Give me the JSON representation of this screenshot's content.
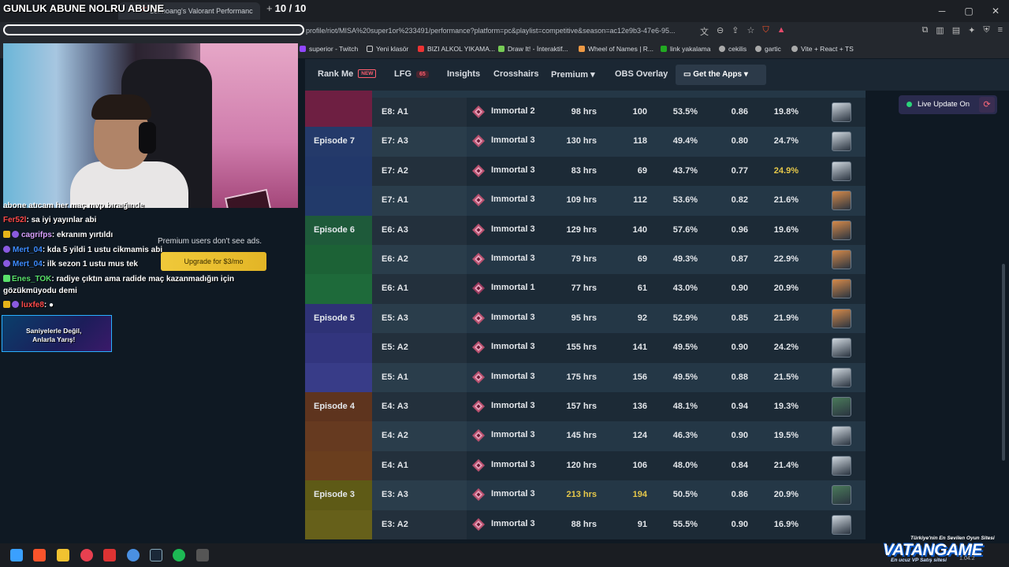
{
  "overlay_title": "GUNLUK ABUNE NOLRU ABUNE",
  "browser": {
    "tab_title": "10#hoang's Valorant Performanc",
    "tab_counter": "10 / 10",
    "url": "profile/riot/MISA%20super1or%233491/performance?platform=pc&playlist=competitive&season=ac12e9b3-47e6-95...",
    "bookmarks": [
      "superior - Twitch",
      "Yeni klasör",
      "BIZI ALKOL YIKAMA...",
      "Draw It! - İnteraktif...",
      "Wheel of Names | R...",
      "link yakalama",
      "cekilis",
      "gartic",
      "Vite + React + TS"
    ]
  },
  "nav": {
    "rank_me": "Rank Me",
    "new_badge": "NEW",
    "lfg": "LFG",
    "lfg_count": "65",
    "insights": "Insights",
    "crosshairs": "Crosshairs",
    "premium": "Premium",
    "obs_overlay": "OBS Overlay",
    "get_apps": "Get the Apps"
  },
  "live_update": "Live Update On",
  "colors": {
    "ep8": "#7a2248",
    "ep7": "#243a6a",
    "ep6": "#1e6a3a",
    "ep5": "#353a86",
    "ep4": "#6a3a22",
    "ep3": "#6a6418",
    "highlight": "#e6c84a"
  },
  "rows": [
    {
      "episode": "",
      "ep_color": "#6e1f42",
      "season": "E8: A1",
      "rank": "Immortal 2",
      "rank_icon": "immortal-2",
      "hrs": "98 hrs",
      "matches": "100",
      "win": "53.5%",
      "kd": "0.86",
      "hs": "19.8%",
      "agent_color": "#cfd7de",
      "hl_hrs": false,
      "hl_matches": false,
      "hl_hs": false
    },
    {
      "episode": "Episode 7",
      "ep_color": "#243a6a",
      "season": "E7: A3",
      "rank": "Immortal 3",
      "rank_icon": "immortal-3",
      "hrs": "130 hrs",
      "matches": "118",
      "win": "49.4%",
      "kd": "0.80",
      "hs": "24.7%",
      "agent_color": "#cfd7de",
      "hl_hrs": false,
      "hl_matches": false,
      "hl_hs": false
    },
    {
      "episode": "",
      "ep_color": "#22386a",
      "season": "E7: A2",
      "rank": "Immortal 3",
      "rank_icon": "immortal-3",
      "hrs": "83 hrs",
      "matches": "69",
      "win": "43.7%",
      "kd": "0.77",
      "hs": "24.9%",
      "agent_color": "#cfd7de",
      "hl_hrs": false,
      "hl_matches": false,
      "hl_hs": true
    },
    {
      "episode": "",
      "ep_color": "#223a6a",
      "season": "E7: A1",
      "rank": "Immortal 3",
      "rank_icon": "immortal-3",
      "hrs": "109 hrs",
      "matches": "112",
      "win": "53.6%",
      "kd": "0.82",
      "hs": "21.6%",
      "agent_color": "#d58a4a",
      "hl_hrs": false,
      "hl_matches": false,
      "hl_hs": false
    },
    {
      "episode": "Episode 6",
      "ep_color": "#1e5a3a",
      "season": "E6: A3",
      "rank": "Immortal 3",
      "rank_icon": "immortal-3",
      "hrs": "129 hrs",
      "matches": "140",
      "win": "57.6%",
      "kd": "0.96",
      "hs": "19.6%",
      "agent_color": "#d58a4a",
      "hl_hrs": false,
      "hl_matches": false,
      "hl_hs": false
    },
    {
      "episode": "",
      "ep_color": "#1c6236",
      "season": "E6: A2",
      "rank": "Immortal 3",
      "rank_icon": "immortal-3",
      "hrs": "79 hrs",
      "matches": "69",
      "win": "49.3%",
      "kd": "0.87",
      "hs": "22.9%",
      "agent_color": "#d58a4a",
      "hl_hrs": false,
      "hl_matches": false,
      "hl_hs": false
    },
    {
      "episode": "",
      "ep_color": "#1e6a3a",
      "season": "E6: A1",
      "rank": "Immortal 1",
      "rank_icon": "immortal-1",
      "hrs": "77 hrs",
      "matches": "61",
      "win": "43.0%",
      "kd": "0.90",
      "hs": "20.9%",
      "agent_color": "#d58a4a",
      "hl_hrs": false,
      "hl_matches": false,
      "hl_hs": false
    },
    {
      "episode": "Episode 5",
      "ep_color": "#2e3276",
      "season": "E5: A3",
      "rank": "Immortal 3",
      "rank_icon": "immortal-3",
      "hrs": "95 hrs",
      "matches": "92",
      "win": "52.9%",
      "kd": "0.85",
      "hs": "21.9%",
      "agent_color": "#d58a4a",
      "hl_hrs": false,
      "hl_matches": false,
      "hl_hs": false
    },
    {
      "episode": "",
      "ep_color": "#32357e",
      "season": "E5: A2",
      "rank": "Immortal 3",
      "rank_icon": "immortal-3",
      "hrs": "155 hrs",
      "matches": "141",
      "win": "49.5%",
      "kd": "0.90",
      "hs": "24.2%",
      "agent_color": "#cfd7de",
      "hl_hrs": false,
      "hl_matches": false,
      "hl_hs": false
    },
    {
      "episode": "",
      "ep_color": "#383c88",
      "season": "E5: A1",
      "rank": "Immortal 3",
      "rank_icon": "immortal-3",
      "hrs": "175 hrs",
      "matches": "156",
      "win": "49.5%",
      "kd": "0.88",
      "hs": "21.5%",
      "agent_color": "#cfd7de",
      "hl_hrs": false,
      "hl_matches": false,
      "hl_hs": false
    },
    {
      "episode": "Episode 4",
      "ep_color": "#5e341e",
      "season": "E4: A3",
      "rank": "Immortal 3",
      "rank_icon": "immortal-3",
      "hrs": "157 hrs",
      "matches": "136",
      "win": "48.1%",
      "kd": "0.94",
      "hs": "19.3%",
      "agent_color": "#4a7a5a",
      "hl_hrs": false,
      "hl_matches": false,
      "hl_hs": false
    },
    {
      "episode": "",
      "ep_color": "#663a20",
      "season": "E4: A2",
      "rank": "Immortal 3",
      "rank_icon": "immortal-3",
      "hrs": "145 hrs",
      "matches": "124",
      "win": "46.3%",
      "kd": "0.90",
      "hs": "19.5%",
      "agent_color": "#cfd7de",
      "hl_hrs": false,
      "hl_matches": false,
      "hl_hs": false
    },
    {
      "episode": "",
      "ep_color": "#6a3e1e",
      "season": "E4: A1",
      "rank": "Immortal 3",
      "rank_icon": "immortal-3",
      "hrs": "120 hrs",
      "matches": "106",
      "win": "48.0%",
      "kd": "0.84",
      "hs": "21.4%",
      "agent_color": "#cfd7de",
      "hl_hrs": false,
      "hl_matches": false,
      "hl_hs": false
    },
    {
      "episode": "Episode 3",
      "ep_color": "#5e5a16",
      "season": "E3: A3",
      "rank": "Immortal 3",
      "rank_icon": "immortal-3",
      "hrs": "213 hrs",
      "matches": "194",
      "win": "50.5%",
      "kd": "0.86",
      "hs": "20.9%",
      "agent_color": "#4a7a5a",
      "hl_hrs": true,
      "hl_matches": true,
      "hl_hs": false
    },
    {
      "episode": "",
      "ep_color": "#66601a",
      "season": "E3: A2",
      "rank": "Immortal 3",
      "rank_icon": "immortal-3",
      "hrs": "88 hrs",
      "matches": "91",
      "win": "55.5%",
      "kd": "0.90",
      "hs": "16.9%",
      "agent_color": "#cfd7de",
      "hl_hrs": false,
      "hl_matches": false,
      "hl_hs": false
    }
  ],
  "stream": {
    "chat": [
      {
        "user": "",
        "text": "abone atıcam her maç mvp bıraığınde"
      },
      {
        "user": "Fer52l",
        "text": "sa iyi yayınlar abi"
      },
      {
        "user": "cagrifps",
        "text": "ekranım yırtıldı"
      },
      {
        "user": "Mert_04",
        "text": "kda 5 yildi 1 ustu cikmamis abi"
      },
      {
        "user": "Mert_04",
        "text": "ilk sezon 1 ustu mus tek"
      },
      {
        "user": "Enes_TOK",
        "text": "radiye çıktın ama radide maç kazanmadığın için"
      },
      {
        "user": "",
        "text": "gözükmüyodu demi"
      },
      {
        "user": "luxfe8",
        "text": ""
      }
    ],
    "premium_note": "Premium users don't see ads.",
    "upgrade": "Upgrade for $3/mo",
    "ad_text_1": "Saniyelerle Değil,",
    "ad_text_2": "Anlarla Yarış!"
  },
  "vatan": {
    "top": "Türkiye'nin En Sevilen Oyun Sitesi",
    "logo": "VATANGAME",
    "sub": "En ucuz VP Satış sitesi",
    "date": "1.04.2"
  }
}
